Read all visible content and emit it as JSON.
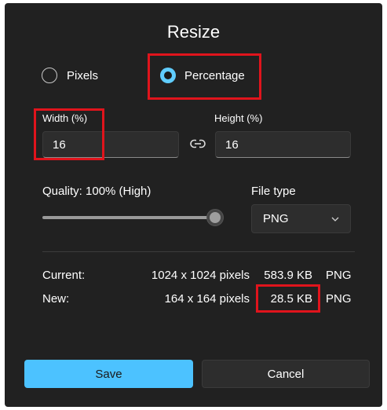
{
  "dialog": {
    "title": "Resize"
  },
  "mode": {
    "options": [
      {
        "label": "Pixels",
        "selected": false
      },
      {
        "label": "Percentage",
        "selected": true
      }
    ]
  },
  "dimensions": {
    "width_label": "Width  (%)",
    "width_value": "16",
    "height_label": "Height  (%)",
    "height_value": "16",
    "link_icon": "link-icon"
  },
  "quality": {
    "label": "Quality: 100% (High)",
    "value_percent": 100
  },
  "file_type": {
    "label": "File type",
    "selected": "PNG"
  },
  "summary": {
    "current": {
      "label": "Current:",
      "dimensions": "1024 x 1024 pixels",
      "size": "583.9 KB",
      "format": "PNG"
    },
    "new": {
      "label": "New:",
      "dimensions": "164 x 164 pixels",
      "size": "28.5 KB",
      "format": "PNG"
    }
  },
  "buttons": {
    "save": "Save",
    "cancel": "Cancel"
  },
  "colors": {
    "dialog_bg": "#212121",
    "accent": "#4cc2ff",
    "highlight": "#e0141c"
  }
}
